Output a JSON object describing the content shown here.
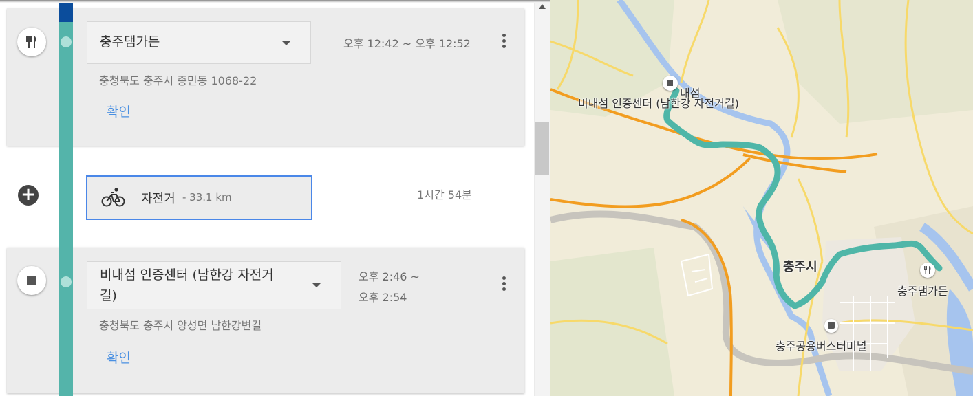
{
  "itinerary": {
    "stop1": {
      "place": "충주댐가든",
      "time": "오후 12:42 ~ 오후 12:52",
      "address": "충청북도 충주시 종민동 1068-22",
      "confirm_label": "확인",
      "icon": "fork-knife-icon"
    },
    "travel": {
      "mode": "자전거",
      "distance": "- 33.1 km",
      "duration": "1시간 54분",
      "icon": "bicycle-icon"
    },
    "stop2": {
      "place_line1": "비내섬 인증센터 (남한강 자전거",
      "place_line2": "길)",
      "time_line1": "오후 2:46 ~",
      "time_line2": "오후 2:54",
      "address": "충청북도 충주시 앙성면 남한강변길",
      "confirm_label": "확인",
      "icon": "square-stop-icon"
    }
  },
  "map": {
    "labels": {
      "binaeseom_fragment": "내섬",
      "binaeseom": "비내섬 인증센터 (남한강 자전거길)",
      "chungju_city": "충주시",
      "dam_garden": "충주댐가든",
      "bus_terminal": "충주공용버스터미널"
    },
    "colors": {
      "route": "#4fb6a8",
      "river": "#a6c4ee",
      "highway": "#f29d20",
      "road": "#f7d96a",
      "land": "#f1ecd9"
    }
  },
  "colors": {
    "timeline_teal": "#54b4aa",
    "timeline_blue": "#0b4d9c",
    "link_blue": "#4a90e2",
    "selected_border": "#4a87e8"
  }
}
